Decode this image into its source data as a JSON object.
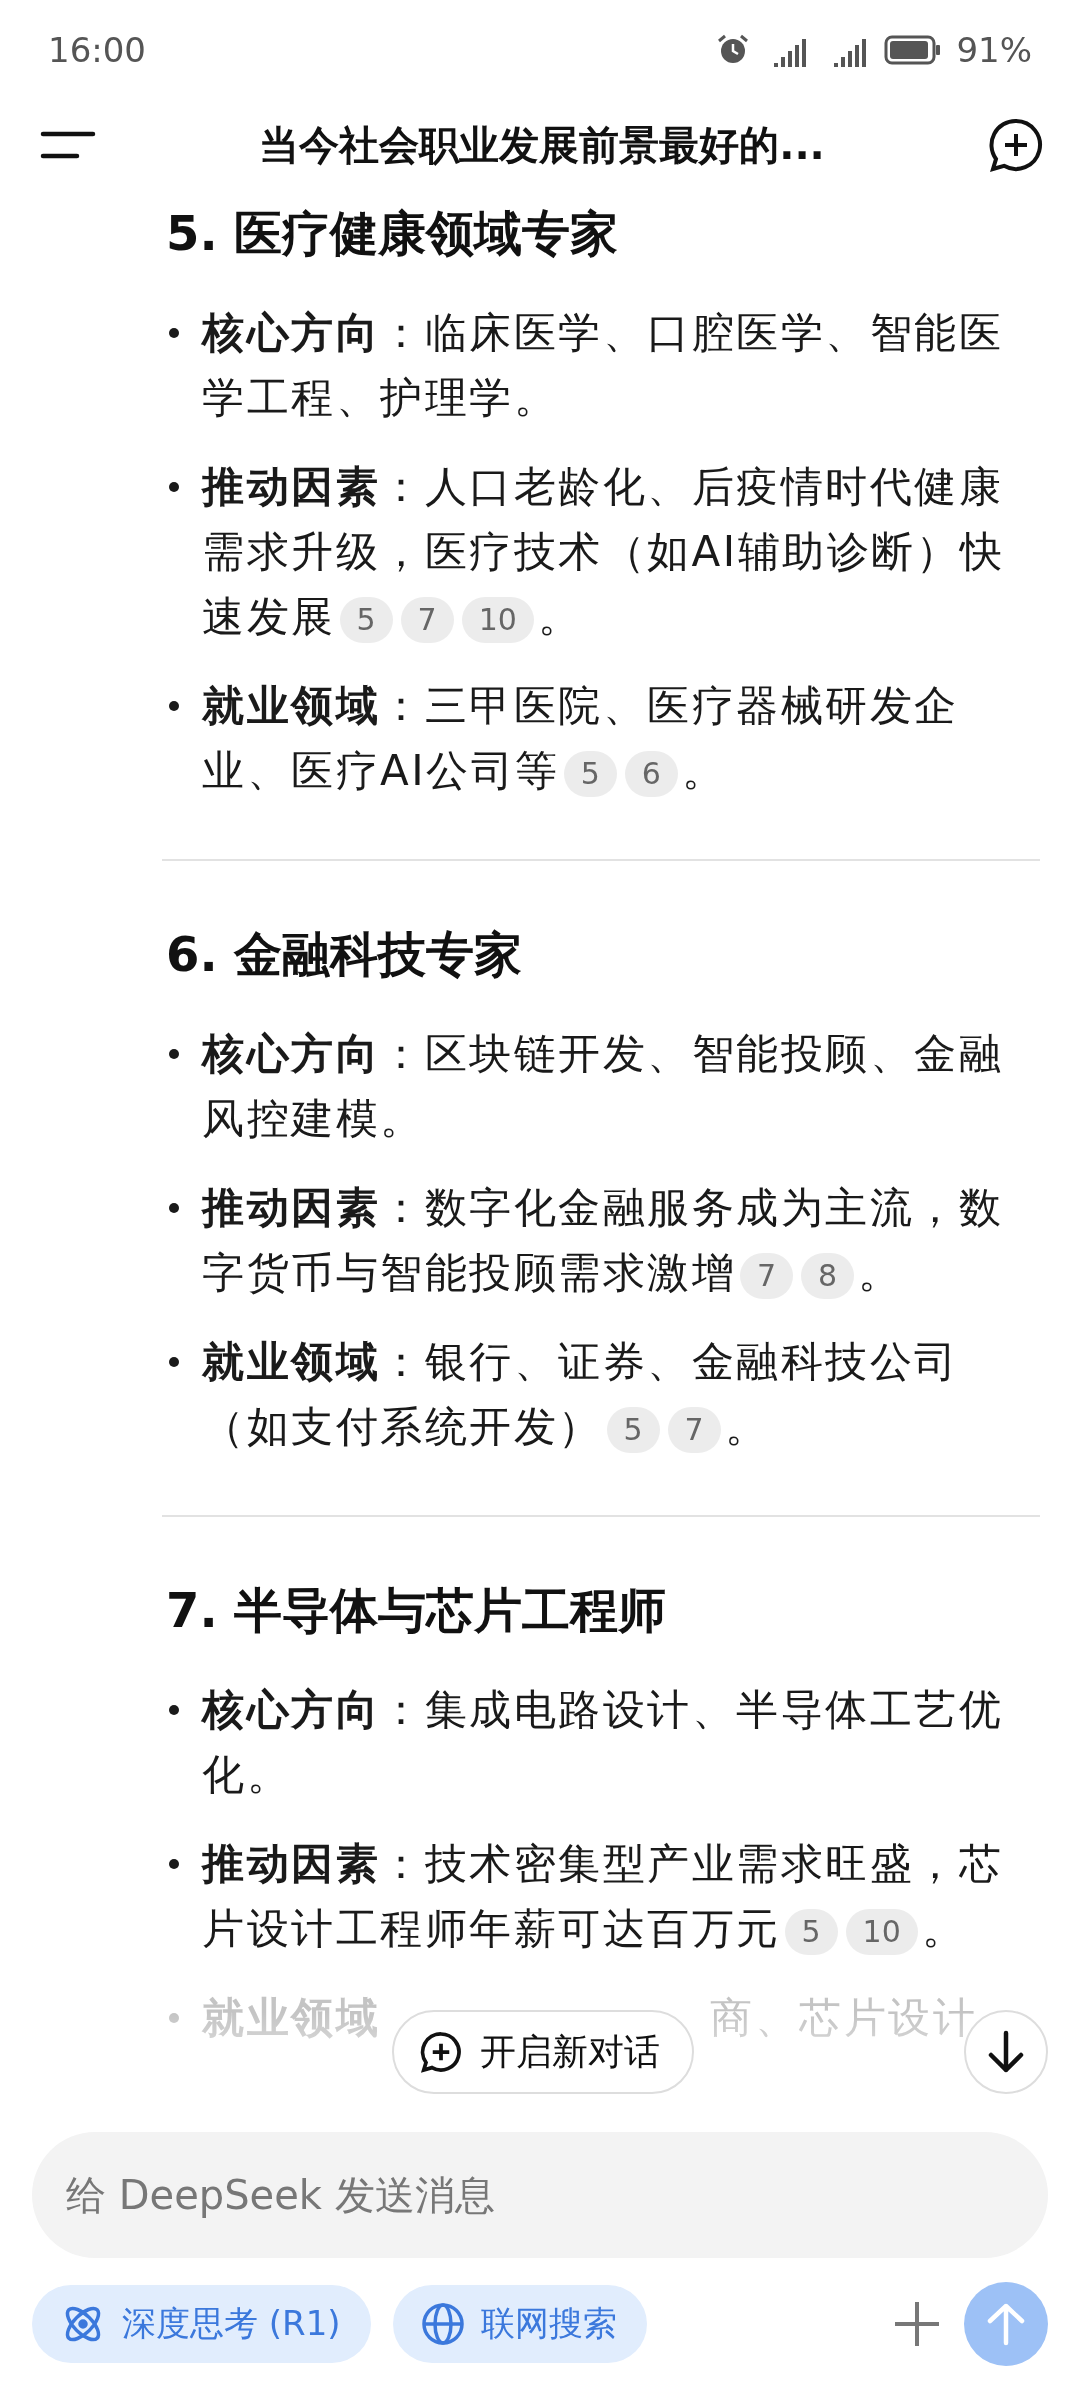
{
  "status_bar": {
    "time": "16:00",
    "battery": "91%"
  },
  "header": {
    "title": "当今社会职业发展前景最好的..."
  },
  "sections": [
    {
      "heading": "5. 医疗健康领域专家",
      "items": [
        {
          "kind": "full",
          "term": "核心方向",
          "text": "：临床医学、口腔医学、智能医学工程、护理学。"
        },
        {
          "kind": "full",
          "term": "推动因素",
          "text": "：人口老龄化、后疫情时代健康需求升级，医疗技术（如AI辅助诊断）快速发展",
          "citations": [
            "5",
            "7",
            "10"
          ],
          "end": "。"
        },
        {
          "kind": "full",
          "term": "就业领域",
          "text": "：三甲医院、医疗器械研发企业、医疗AI公司等",
          "citations": [
            "5",
            "6"
          ],
          "end": "。"
        }
      ]
    },
    {
      "heading": "6. 金融科技专家",
      "items": [
        {
          "kind": "full",
          "term": "核心方向",
          "text": "：区块链开发、智能投顾、金融风控建模。"
        },
        {
          "kind": "full",
          "term": "推动因素",
          "text": "：数字化金融服务成为主流，数字货币与智能投顾需求激增",
          "citations": [
            "7",
            "8"
          ],
          "end": "。"
        },
        {
          "kind": "full",
          "term": "就业领域",
          "text": "：银行、证券、金融科技公司（如支付系统开发）",
          "citations": [
            "5",
            "7"
          ],
          "end": "。"
        }
      ]
    },
    {
      "heading": "7. 半导体与芯片工程师",
      "items": [
        {
          "kind": "full",
          "term": "核心方向",
          "text": "：集成电路设计、半导体工艺优化。"
        },
        {
          "kind": "full",
          "term": "推动因素",
          "text": "：技术密集型产业需求旺盛，芯片设计工程师年薪可达百万元",
          "citations": [
            "5",
            "10"
          ],
          "end": "。"
        },
        {
          "kind": "faded",
          "term": "就业领域",
          "text": "商、芯片设计"
        }
      ]
    }
  ],
  "new_chat_button": {
    "label": "开启新对话"
  },
  "composer": {
    "placeholder": "给 DeepSeek 发送消息"
  },
  "chips": [
    {
      "kind": "think",
      "label": "深度思考 (R1)",
      "selected": false
    },
    {
      "kind": "search",
      "label": "联网搜索",
      "selected": false
    }
  ]
}
